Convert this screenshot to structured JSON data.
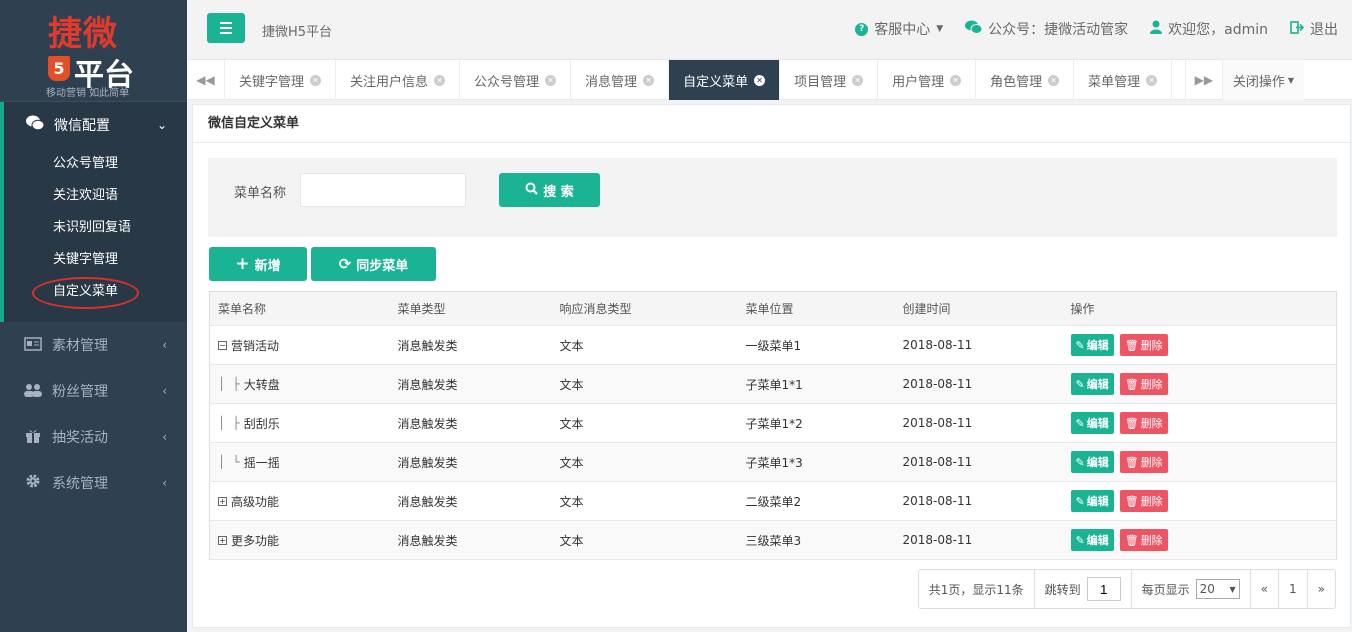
{
  "logo": {
    "title": "捷微",
    "sub": "平台",
    "shield": "5",
    "slogan": "移动营销 如此简单"
  },
  "sidebar": {
    "groups": [
      {
        "label": "微信配置",
        "icon": "wechat-icon",
        "caret": "⌄",
        "items": [
          "公众号管理",
          "关注欢迎语",
          "未识别回复语",
          "关键字管理",
          "自定义菜单"
        ]
      },
      {
        "label": "素材管理",
        "icon": "card-icon",
        "caret": "‹"
      },
      {
        "label": "粉丝管理",
        "icon": "users-icon",
        "caret": "‹"
      },
      {
        "label": "抽奖活动",
        "icon": "gift-icon",
        "caret": "‹"
      },
      {
        "label": "系统管理",
        "icon": "gear-icon",
        "caret": "‹"
      }
    ]
  },
  "topbar": {
    "platform": "捷微H5平台",
    "service": "客服中心",
    "account": "公众号：捷微活动管家",
    "welcome": "欢迎您，admin",
    "logout": "退出"
  },
  "tabs": {
    "items": [
      "关键字管理",
      "关注用户信息",
      "公众号管理",
      "消息管理",
      "自定义菜单",
      "项目管理",
      "用户管理",
      "角色管理",
      "菜单管理"
    ],
    "active_index": 4,
    "close_ops": "关闭操作"
  },
  "panel": {
    "title": "微信自定义菜单"
  },
  "search": {
    "label": "菜单名称",
    "value": "",
    "button": "搜 索"
  },
  "actions": {
    "add": "新增",
    "sync": "同步菜单"
  },
  "table": {
    "headers": [
      "菜单名称",
      "菜单类型",
      "响应消息类型",
      "菜单位置",
      "创建时间",
      "操作"
    ],
    "rows": [
      {
        "prefix": "⊟",
        "name": "营销活动",
        "type": "消息触发类",
        "resp": "文本",
        "pos": "一级菜单1",
        "date": "2018-08-11"
      },
      {
        "prefix": "│ ├",
        "name": "大转盘",
        "type": "消息触发类",
        "resp": "文本",
        "pos": "子菜单1*1",
        "date": "2018-08-11"
      },
      {
        "prefix": "│ ├",
        "name": "刮刮乐",
        "type": "消息触发类",
        "resp": "文本",
        "pos": "子菜单1*2",
        "date": "2018-08-11"
      },
      {
        "prefix": "│ └",
        "name": "摇一摇",
        "type": "消息触发类",
        "resp": "文本",
        "pos": "子菜单1*3",
        "date": "2018-08-11"
      },
      {
        "prefix": "⊞",
        "name": "高级功能",
        "type": "消息触发类",
        "resp": "文本",
        "pos": "二级菜单2",
        "date": "2018-08-11"
      },
      {
        "prefix": "⊞",
        "name": "更多功能",
        "type": "消息触发类",
        "resp": "文本",
        "pos": "三级菜单3",
        "date": "2018-08-11"
      }
    ],
    "edit_label": "编辑",
    "delete_label": "删除"
  },
  "pager": {
    "summary": "共1页，显示11条",
    "jump_label": "跳转到",
    "jump_value": "1",
    "per_page_label": "每页显示",
    "per_page_value": "20",
    "prev": "«",
    "page": "1",
    "next": "»"
  },
  "colors": {
    "primary": "#1ab394",
    "sidebar": "#2f4050",
    "danger": "#ed5565",
    "logo_red": "#e03a2e"
  }
}
